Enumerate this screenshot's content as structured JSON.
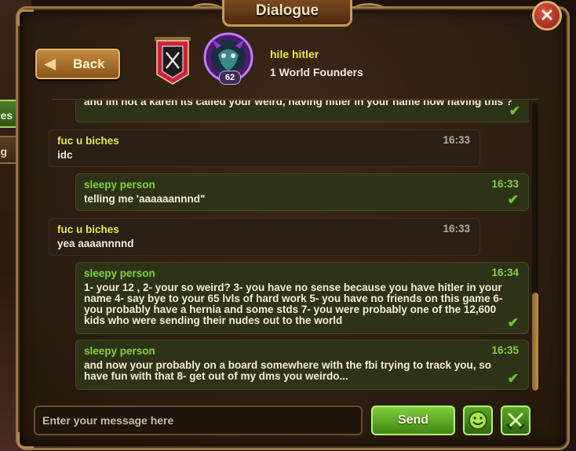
{
  "window": {
    "title": "Dialogue"
  },
  "sidebar": {
    "tabs": [
      {
        "label": "ges",
        "active": true
      },
      {
        "label": "ng",
        "active": false
      }
    ]
  },
  "header": {
    "back_label": "Back",
    "profile": {
      "name": "hile hitler",
      "guild": "1 World Founders",
      "level": "62"
    }
  },
  "messages": [
    {
      "direction": "out",
      "sender": "",
      "time": "",
      "text": "and im not a karen its called your weird, having hitler in your name now having this ?",
      "read": true
    },
    {
      "direction": "in",
      "sender": "fuc u biches",
      "time": "16:33",
      "text": "idc",
      "read": false
    },
    {
      "direction": "out",
      "sender": "sleepy person",
      "time": "16:33",
      "text": "telling me 'aaaaaannnd\"",
      "read": true
    },
    {
      "direction": "in",
      "sender": "fuc u biches",
      "time": "16:33",
      "text": "yea aaaannnnd",
      "read": false
    },
    {
      "direction": "out",
      "sender": "sleepy person",
      "time": "16:34",
      "text": "1- your 12 , 2- your so weird? 3- you have no sense because you have hitler in your name 4- say bye to your 65 lvls of hard work 5- you have no friends on this game 6- you probably have a hernia and some stds 7- you were probably one of the 12,600 kids who were sending their nudes out to the world",
      "read": true
    },
    {
      "direction": "out",
      "sender": "sleepy person",
      "time": "16:35",
      "text": "and now your probably on a board somewhere with the fbi trying to track you, so have fun with that 8- get out of my dms you weirdo...",
      "read": true
    }
  ],
  "composer": {
    "placeholder": "Enter your message here",
    "value": "",
    "send_label": "Send"
  },
  "colors": {
    "incoming_sender": "#e8e844",
    "outgoing_sender": "#7fd33b",
    "send_button": "#5fae25",
    "frame": "#9a7647"
  }
}
